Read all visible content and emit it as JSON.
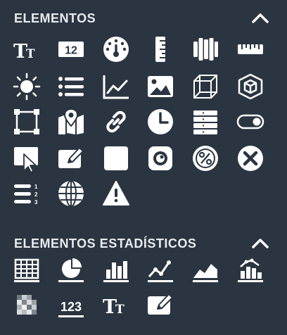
{
  "sections": [
    {
      "title": "ELEMENTOS",
      "collapsed": false,
      "items": [
        {
          "icon": "text-icon"
        },
        {
          "icon": "number-icon",
          "text": "12"
        },
        {
          "icon": "gauge-icon"
        },
        {
          "icon": "ruler-vertical-icon"
        },
        {
          "icon": "bars-vertical-icon"
        },
        {
          "icon": "ruler-horizontal-icon"
        },
        {
          "icon": "sun-icon"
        },
        {
          "icon": "list-icon"
        },
        {
          "icon": "line-chart-icon"
        },
        {
          "icon": "image-icon"
        },
        {
          "icon": "cube-wireframe-icon"
        },
        {
          "icon": "cube-3d-icon"
        },
        {
          "icon": "shape-select-icon"
        },
        {
          "icon": "map-marker-icon"
        },
        {
          "icon": "link-icon"
        },
        {
          "icon": "clock-icon"
        },
        {
          "icon": "stack-icon"
        },
        {
          "icon": "toggle-icon"
        },
        {
          "icon": "pointer-select-icon"
        },
        {
          "icon": "edit-icon"
        },
        {
          "icon": "square-icon"
        },
        {
          "icon": "webcam-icon"
        },
        {
          "icon": "percent-icon"
        },
        {
          "icon": "close-circle-icon"
        },
        {
          "icon": "ordered-list-icon",
          "text": [
            "1",
            "2",
            "3"
          ]
        },
        {
          "icon": "globe-icon"
        },
        {
          "icon": "warning-icon"
        }
      ]
    },
    {
      "title": "ELEMENTOS ESTADÍSTICOS",
      "collapsed": false,
      "items": [
        {
          "icon": "table-icon"
        },
        {
          "icon": "pie-chart-icon"
        },
        {
          "icon": "bar-chart-icon"
        },
        {
          "icon": "line-chart-icon"
        },
        {
          "icon": "area-chart-icon"
        },
        {
          "icon": "column-line-chart-icon"
        },
        {
          "icon": "heatmap-icon"
        },
        {
          "icon": "number-kpi-icon",
          "text": "123"
        },
        {
          "icon": "text-icon"
        },
        {
          "icon": "edit-icon"
        }
      ]
    }
  ]
}
